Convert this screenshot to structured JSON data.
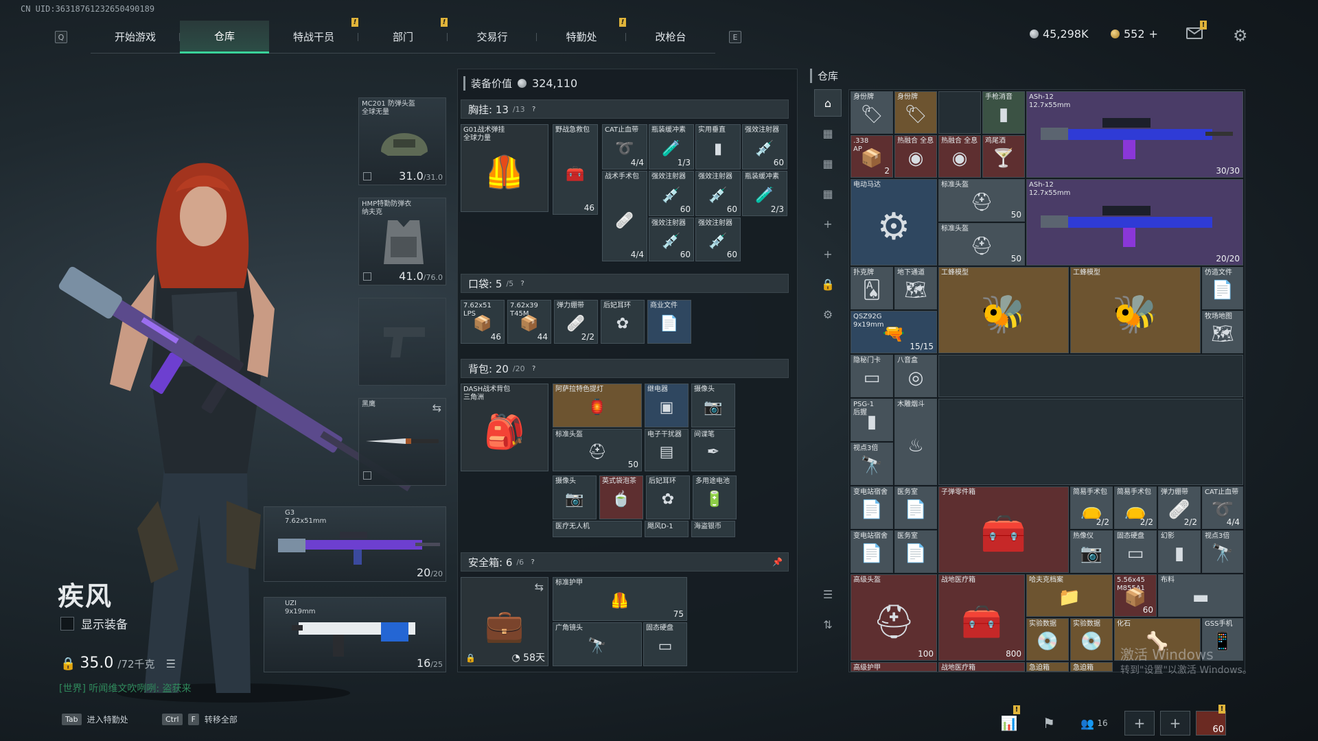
{
  "uid": "CN UID:36318761232650490189",
  "nav": {
    "left_key": "Q",
    "right_key": "E",
    "tabs": [
      {
        "label": "开始游戏",
        "alert": false
      },
      {
        "label": "仓库",
        "alert": false,
        "active": true
      },
      {
        "label": "特战干员",
        "alert": true
      },
      {
        "label": "部门",
        "alert": true
      },
      {
        "label": "交易行",
        "alert": false
      },
      {
        "label": "特勤处",
        "alert": true
      },
      {
        "label": "改枪台",
        "alert": false
      }
    ],
    "alert_mark": "!"
  },
  "currency": {
    "coins": "45,298K",
    "tickets": "552",
    "plus": "+"
  },
  "character": {
    "name": "疾风",
    "show_gear_label": "显示装备",
    "weight": "35.0",
    "weight_max": "/72千克",
    "world_chat": "[世界] 听闻维文吹咧咧: 盗获来"
  },
  "hints": [
    {
      "keys": [
        "Tab"
      ],
      "label": "进入特勤处"
    },
    {
      "keys": [
        "Ctrl",
        "F"
      ],
      "label": "转移全部"
    }
  ],
  "equipment": {
    "helmet": {
      "label": "MC201 防弹头盔\n全球无量",
      "value": "31.0",
      "max": "/31.0"
    },
    "armor": {
      "label": "HMP特勤防弹衣\n纳夫克",
      "value": "41.0",
      "max": "/76.0"
    },
    "knife_label": "黑鹰",
    "primary": {
      "label": "G3\n7.62x51mm",
      "ammo": "20",
      "ammo_max": "/20"
    },
    "secondary": {
      "label": "UZI\n9x19mm",
      "ammo": "16",
      "ammo_max": "/25"
    }
  },
  "loadout": {
    "title": "装备价值",
    "value": "324,110",
    "chest_rig": {
      "label": "胸挂: 13",
      "cap": "/13",
      "item": "G01战术弹挂\n全球力量"
    },
    "pockets": {
      "label": "口袋: 5",
      "cap": "/5"
    },
    "backpack": {
      "label": "背包: 20",
      "cap": "/20",
      "item": "DASH战术背包\n三角洲"
    },
    "safebox": {
      "label": "安全箱: 6",
      "cap": "/6",
      "timer": "58天"
    },
    "chest_items": [
      {
        "name": "野战急救包",
        "count": "46"
      },
      {
        "name": "CAT止血带",
        "count": "4/4"
      },
      {
        "name": "瓶装缓冲素",
        "count": "1/3"
      },
      {
        "name": "实用垂直",
        "count": ""
      },
      {
        "name": "强效注射器",
        "count": "60"
      },
      {
        "name": "战术手术包",
        "count": "4/4"
      },
      {
        "name": "强效注射器",
        "count": "60"
      },
      {
        "name": "强效注射器",
        "count": "60"
      },
      {
        "name": "瓶装缓冲素",
        "count": "2/3"
      },
      {
        "name": "强效注射器",
        "count": "60"
      },
      {
        "name": "强效注射器",
        "count": "60"
      }
    ],
    "pocket_items": [
      {
        "name": "7.62x51\nLPS",
        "count": "46"
      },
      {
        "name": "7.62x39\nT45M",
        "count": "44"
      },
      {
        "name": "弹力绷带",
        "count": "2/2"
      },
      {
        "name": "后妃耳环",
        "count": ""
      },
      {
        "name": "商业文件",
        "count": ""
      }
    ],
    "backpack_items": [
      {
        "name": "阿萨拉特色提灯",
        "count": ""
      },
      {
        "name": "继电器",
        "count": ""
      },
      {
        "name": "摄像头",
        "count": ""
      },
      {
        "name": "标准头盔",
        "count": "50"
      },
      {
        "name": "电子干扰器",
        "count": ""
      },
      {
        "name": "间谍笔",
        "count": ""
      },
      {
        "name": "摄像头",
        "count": ""
      },
      {
        "name": "英式袋泡茶",
        "count": ""
      },
      {
        "name": "后妃耳环",
        "count": ""
      },
      {
        "name": "多用途电池",
        "count": ""
      },
      {
        "name": "医疗无人机",
        "count": ""
      },
      {
        "name": "飓风D-1",
        "count": ""
      },
      {
        "name": "海盗银币",
        "count": ""
      }
    ],
    "safebox_items": [
      {
        "name": "标准护甲",
        "count": "75"
      },
      {
        "name": "广角镜头",
        "count": ""
      },
      {
        "name": "固态硬盘",
        "count": ""
      }
    ]
  },
  "warehouse": {
    "title": "仓库",
    "items": [
      {
        "name": "身份牌",
        "count": ""
      },
      {
        "name": "身份牌",
        "count": ""
      },
      {
        "name": "手枪消音",
        "count": ""
      },
      {
        "name": "ASh-12\n12.7x55mm",
        "count": "30/30"
      },
      {
        "name": ".338\nAP",
        "count": "2"
      },
      {
        "name": "热融合 全息",
        "count": ""
      },
      {
        "name": "热融合 全息",
        "count": ""
      },
      {
        "name": "鸡尾酒",
        "count": ""
      },
      {
        "name": "电动马达",
        "count": ""
      },
      {
        "name": "标准头盔",
        "count": "50"
      },
      {
        "name": "ASh-12\n12.7x55mm",
        "count": "20/20"
      },
      {
        "name": "标准头盔",
        "count": "50"
      },
      {
        "name": "扑克牌",
        "count": ""
      },
      {
        "name": "地下通道",
        "count": ""
      },
      {
        "name": "工蜂模型",
        "count": ""
      },
      {
        "name": "工蜂模型",
        "count": ""
      },
      {
        "name": "仿造文件",
        "count": ""
      },
      {
        "name": "QSZ92G\n9x19mm",
        "count": "15/15"
      },
      {
        "name": "牧场地图",
        "count": ""
      },
      {
        "name": "隐秘门卡",
        "count": ""
      },
      {
        "name": "八音盒",
        "count": ""
      },
      {
        "name": "PSG-1\n后握",
        "count": ""
      },
      {
        "name": "木雕烟斗",
        "count": ""
      },
      {
        "name": "视点3倍",
        "count": ""
      },
      {
        "name": "变电站宿舍",
        "count": ""
      },
      {
        "name": "医务室",
        "count": ""
      },
      {
        "name": "子弹零件箱",
        "count": ""
      },
      {
        "name": "简易手术包",
        "count": "2/2"
      },
      {
        "name": "简易手术包",
        "count": "2/2"
      },
      {
        "name": "弹力绷带",
        "count": "2/2"
      },
      {
        "name": "CAT止血带",
        "count": "4/4"
      },
      {
        "name": "变电站宿舍",
        "count": ""
      },
      {
        "name": "医务室",
        "count": ""
      },
      {
        "name": "热像仪",
        "count": ""
      },
      {
        "name": "固态硬盘",
        "count": ""
      },
      {
        "name": "幻影",
        "count": ""
      },
      {
        "name": "视点3倍",
        "count": ""
      },
      {
        "name": "高级头盔",
        "count": "100"
      },
      {
        "name": "战地医疗箱",
        "count": "800"
      },
      {
        "name": "哈夫克档案",
        "count": ""
      },
      {
        "name": "5.56x45\nM855A1",
        "count": "60"
      },
      {
        "name": "布料",
        "count": ""
      },
      {
        "name": "实验数据",
        "count": ""
      },
      {
        "name": "实验数据",
        "count": ""
      },
      {
        "name": "化石",
        "count": ""
      },
      {
        "name": "GSS手机",
        "count": ""
      },
      {
        "name": "高级护甲",
        "count": ""
      },
      {
        "name": "战地医疗箱",
        "count": ""
      },
      {
        "name": "急迫箱",
        "count": ""
      },
      {
        "name": "急迫箱",
        "count": ""
      }
    ]
  },
  "watermark": {
    "line1": "激活 Windows",
    "line2": "转到\"设置\"以激活 Windows。"
  },
  "bottom": {
    "friends": "16",
    "level": "60"
  },
  "colors": {
    "accent": "#3ad39a",
    "alert": "#e0b43a",
    "weapon_purple": "#7b3fd1",
    "weapon_blue": "#2466d4"
  }
}
